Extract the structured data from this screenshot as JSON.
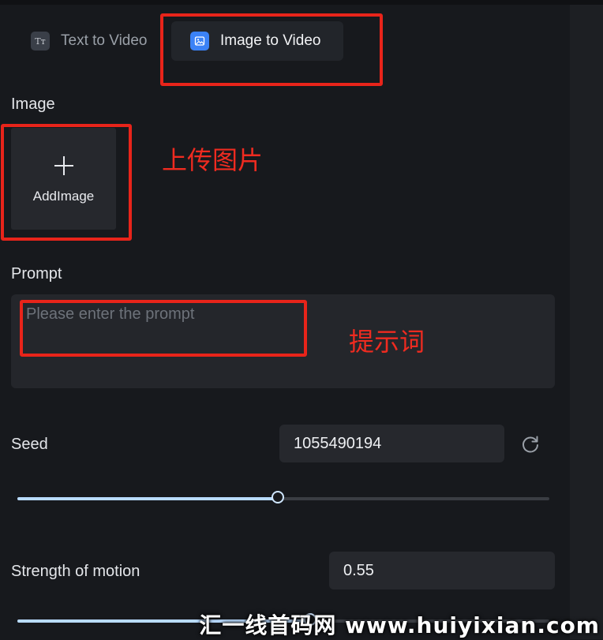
{
  "tabs": [
    {
      "label": "Text to Video",
      "icon": "text-format-icon",
      "icon_glyph": "Tт",
      "active": false
    },
    {
      "label": "Image to Video",
      "icon": "image-icon",
      "active": true
    }
  ],
  "image_section": {
    "label": "Image",
    "add_button_label": "AddImage"
  },
  "prompt_section": {
    "label": "Prompt",
    "placeholder": "Please enter the prompt",
    "value": ""
  },
  "seed": {
    "label": "Seed",
    "value": "1055490194",
    "slider_fraction": 0.49
  },
  "motion": {
    "label": "Strength of motion",
    "value": "0.55",
    "slider_fraction": 0.55
  },
  "annotations": {
    "upload_note": "上传图片",
    "prompt_note": "提示词"
  },
  "watermark": "汇一线首码网 www.huiyixian.com",
  "colors": {
    "accent_blue": "#3b82f6",
    "slider_fill": "#b9dbff",
    "annotation_red": "#e8241a",
    "background": "#17191d"
  }
}
